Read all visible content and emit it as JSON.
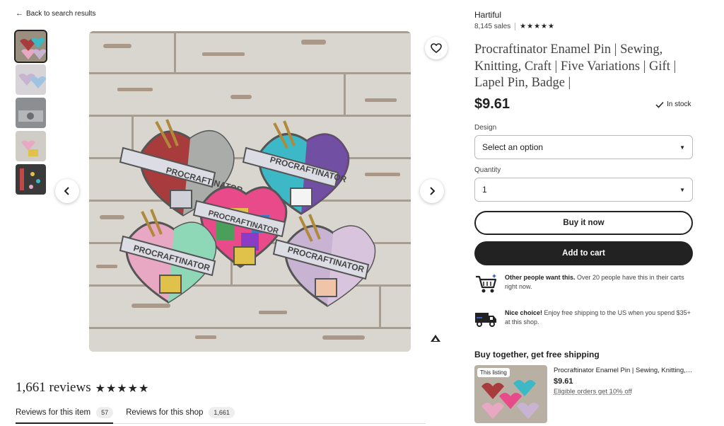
{
  "nav": {
    "back_label": "Back to search results"
  },
  "reviews": {
    "heading": "1,661 reviews",
    "stars": "★★★★★",
    "tabs": [
      {
        "label": "Reviews for this item",
        "count": "57"
      },
      {
        "label": "Reviews for this shop",
        "count": "1,661"
      }
    ]
  },
  "pin_banner_text": "PROCRAFTINATOR",
  "shop": {
    "name": "Hartiful",
    "sales": "8,145 sales",
    "stars": "★★★★★"
  },
  "listing": {
    "title": "Procraftinator Enamel Pin | Sewing, Knitting, Craft | Five Variations | Gift | Lapel Pin, Badge |",
    "price": "$9.61",
    "stock": "In stock"
  },
  "design": {
    "label": "Design",
    "value": "Select an option"
  },
  "quantity": {
    "label": "Quantity",
    "value": "1"
  },
  "buttons": {
    "buy_now": "Buy it now",
    "add_to_cart": "Add to cart"
  },
  "info": {
    "demand_bold": "Other people want this.",
    "demand_text": " Over 20 people have this in their carts right now.",
    "shipping_bold": "Nice choice!",
    "shipping_text": " Enjoy free shipping to the US when you spend $35+ at this shop."
  },
  "bundle": {
    "heading": "Buy together, get free shipping",
    "tag": "This listing",
    "title": "Procraftinator Enamel Pin | Sewing, Knitting, Craft | Five Variations",
    "price": "$9.61",
    "note": "Eligible orders get 10% off"
  },
  "colors": {
    "accent": "#222222",
    "wood": "#8a7c6a",
    "pin_red": "#a83b3b",
    "pin_teal": "#3cb8c6",
    "pin_pink": "#e8a8c4",
    "pin_lilac": "#c8b4d2"
  }
}
